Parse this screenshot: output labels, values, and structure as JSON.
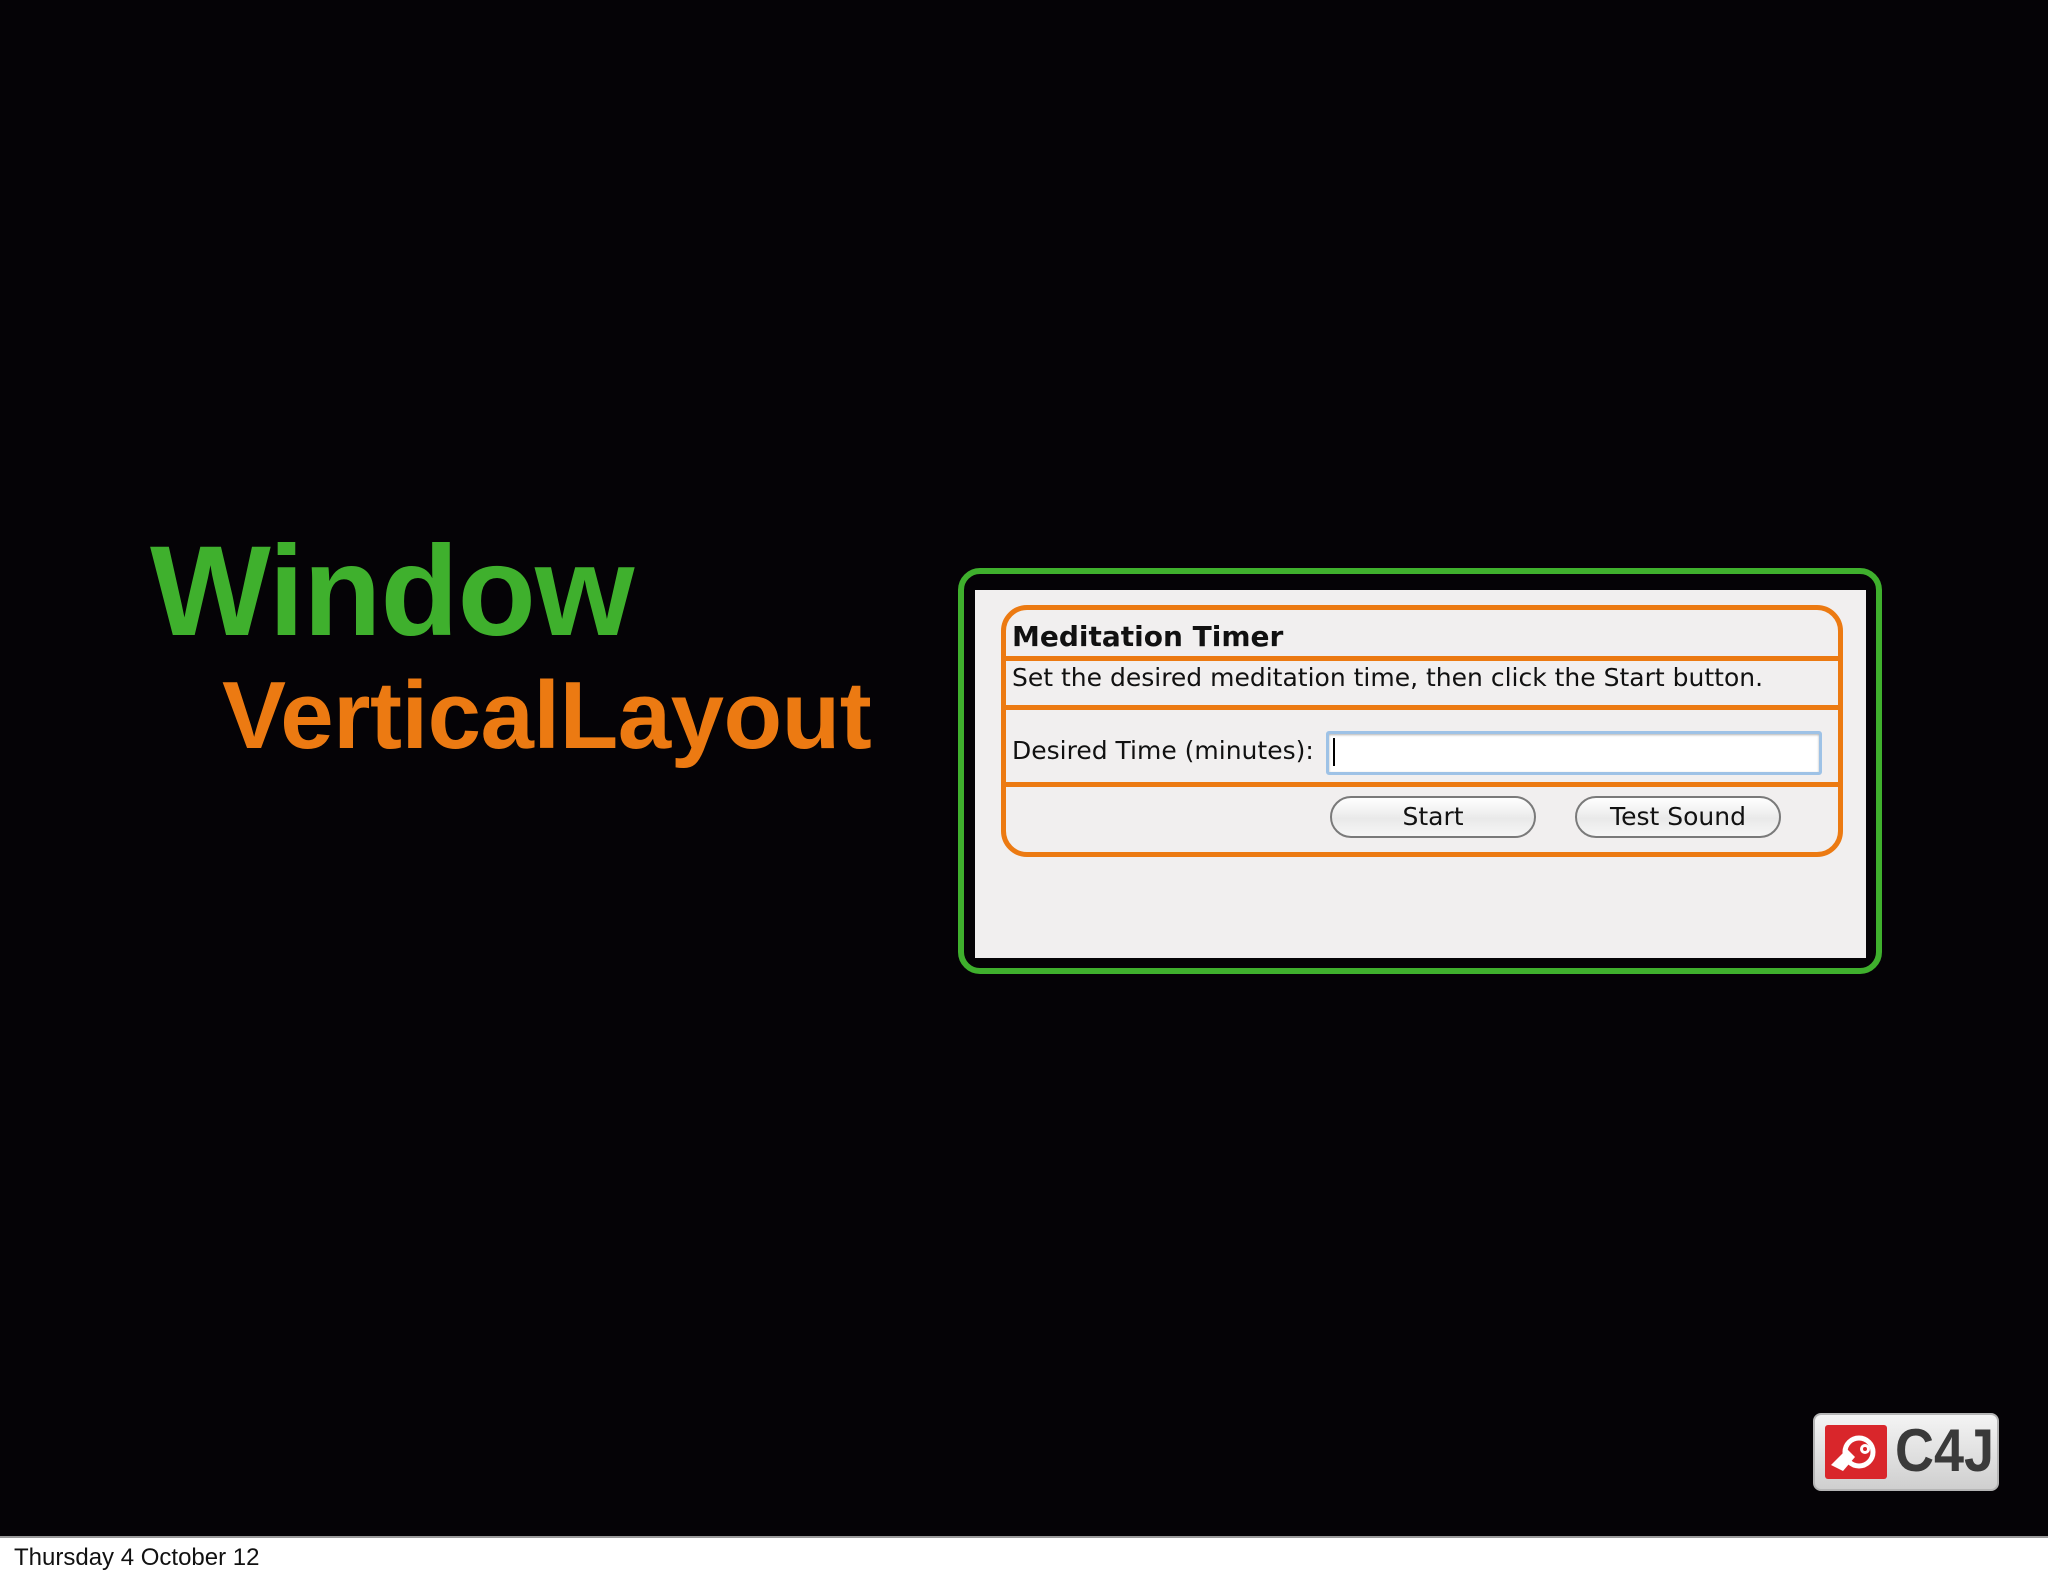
{
  "slide": {
    "title": "Window",
    "subtitle": "VerticalLayout",
    "footer_date": "Thursday 4 October 12"
  },
  "dialog": {
    "heading": "Meditation Timer",
    "description": "Set the desired meditation time, then click the Start button.",
    "time_label": "Desired Time (minutes):",
    "time_value": "",
    "start_label": "Start",
    "test_sound_label": "Test Sound"
  },
  "logo": {
    "text": "C4J",
    "icon": "c4j-emblem-icon"
  },
  "colors": {
    "background": "#050306",
    "window_accent": "#3fb02d",
    "layout_accent": "#ec7a12",
    "dialog_background": "#f1efef"
  }
}
